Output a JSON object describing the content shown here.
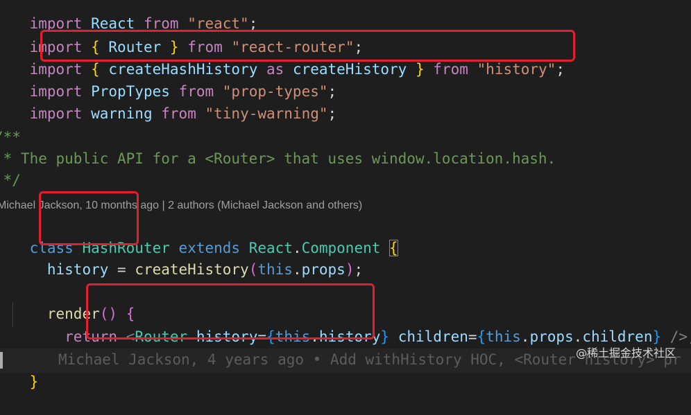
{
  "code_lines": {
    "l1": {
      "kw1": "import",
      "p1": " ",
      "v1": "React",
      "p2": " ",
      "kw2": "from",
      "p3": " ",
      "s1": "\"react\"",
      "p4": ";"
    },
    "l2": {
      "kw1": "import",
      "p1": " ",
      "b1": "{",
      "p2": " ",
      "v1": "Router",
      "p3": " ",
      "b2": "}",
      "p4": " ",
      "kw2": "from",
      "p5": " ",
      "s1": "\"react-router\"",
      "p6": ";"
    },
    "l3": {
      "kw1": "import",
      "p1": " ",
      "b1": "{",
      "p2": " ",
      "v1": "createHashHistory",
      "p3": " ",
      "kw2": "as",
      "p4": " ",
      "v2": "createHistory",
      "p5": " ",
      "b2": "}",
      "p6": " ",
      "kw3": "from",
      "p7": " ",
      "s1": "\"history\"",
      "p8": ";"
    },
    "l4": {
      "kw1": "import",
      "p1": " ",
      "v1": "PropTypes",
      "p2": " ",
      "kw2": "from",
      "p3": " ",
      "s1": "\"prop-types\"",
      "p4": ";"
    },
    "l5": {
      "kw1": "import",
      "p1": " ",
      "v1": "warning",
      "p2": " ",
      "kw2": "from",
      "p3": " ",
      "s1": "\"tiny-warning\"",
      "p4": ";"
    },
    "l6": {
      "c": "/**"
    },
    "l7": {
      "c": " * The public API for a <Router> that uses window.location.hash."
    },
    "l8": {
      "c": " */"
    },
    "l9": {
      "kw1": "class",
      "p1": " ",
      "c1": "HashRouter",
      "p2": " ",
      "kw2": "extends",
      "p3": " ",
      "c2": "React",
      "p4": ".",
      "c3": "Component",
      "p5": " ",
      "b1": "{"
    },
    "l10": {
      "p0": "  ",
      "v1": "history",
      "p1": " = ",
      "f1": "createHistory",
      "b1": "(",
      "kw1": "this",
      "p2": ".",
      "v2": "props",
      "b2": ")",
      "p3": ";"
    },
    "l12": {
      "p0": "  ",
      "f1": "render",
      "b1": "()",
      "p1": " ",
      "b2": "{"
    },
    "l13": {
      "p0": "    ",
      "kw1": "return",
      "p1": " ",
      "t1": "<",
      "c1": "Router",
      "p2": " ",
      "a1": "history",
      "p3": "=",
      "b1": "{",
      "kw2": "this",
      "p4": ".",
      "v1": "history",
      "b2": "}",
      "p5": " ",
      "a2": "children",
      "p6": "=",
      "b3": "{",
      "kw3": "this",
      "p7": ".",
      "v2": "props",
      "p8": ".",
      "v3": "children",
      "b4": "}",
      "p9": " ",
      "t2": "/>",
      "p10": ";"
    },
    "l14": {
      "p0": "  ",
      "b1": "}"
    },
    "l15": {
      "b1": "}"
    }
  },
  "codelens_text": "Michael Jackson, 10 months ago | 2 authors (Michael Jackson and others)",
  "inline_blame": "Michael Jackson, 4 years ago • Add withHistory HOC, <Router history> pr",
  "watermark": "@稀土掘金技术社区",
  "colors": {
    "highlight_box": "#e0202e",
    "background": "#1e1e1e"
  }
}
